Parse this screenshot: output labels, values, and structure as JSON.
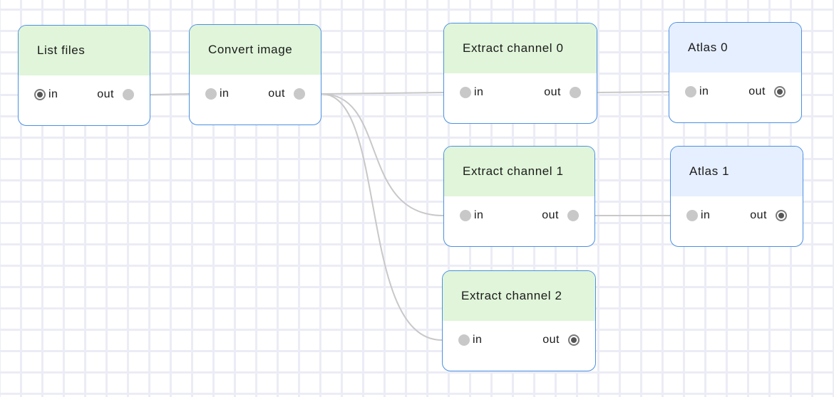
{
  "nodes": [
    {
      "id": "list-files",
      "title": "List files",
      "theme": "green",
      "in_label": "in",
      "out_label": "out",
      "in_state": "active",
      "out_state": "inactive"
    },
    {
      "id": "convert-image",
      "title": "Convert image",
      "theme": "green",
      "in_label": "in",
      "out_label": "out",
      "in_state": "inactive",
      "out_state": "inactive"
    },
    {
      "id": "extract-channel-0",
      "title": "Extract channel 0",
      "theme": "green",
      "in_label": "in",
      "out_label": "out",
      "in_state": "inactive",
      "out_state": "inactive"
    },
    {
      "id": "atlas-0",
      "title": "Atlas 0",
      "theme": "blue",
      "in_label": "in",
      "out_label": "out",
      "in_state": "inactive",
      "out_state": "active"
    },
    {
      "id": "extract-channel-1",
      "title": "Extract channel 1",
      "theme": "green",
      "in_label": "in",
      "out_label": "out",
      "in_state": "inactive",
      "out_state": "inactive"
    },
    {
      "id": "atlas-1",
      "title": "Atlas 1",
      "theme": "blue",
      "in_label": "in",
      "out_label": "out",
      "in_state": "inactive",
      "out_state": "active"
    },
    {
      "id": "extract-channel-2",
      "title": "Extract channel 2",
      "theme": "green",
      "in_label": "in",
      "out_label": "out",
      "in_state": "inactive",
      "out_state": "active"
    }
  ],
  "connections": [
    {
      "from": "list-files",
      "to": "convert-image"
    },
    {
      "from": "convert-image",
      "to": "extract-channel-0"
    },
    {
      "from": "convert-image",
      "to": "extract-channel-1"
    },
    {
      "from": "convert-image",
      "to": "extract-channel-2"
    },
    {
      "from": "extract-channel-0",
      "to": "atlas-0"
    },
    {
      "from": "extract-channel-1",
      "to": "atlas-1"
    }
  ],
  "colors": {
    "green_header": "#e0f5d9",
    "blue_header": "#e6efff",
    "node_border": "#4a90e2",
    "wire": "#c8c8c8",
    "grid": "#ececf6"
  }
}
